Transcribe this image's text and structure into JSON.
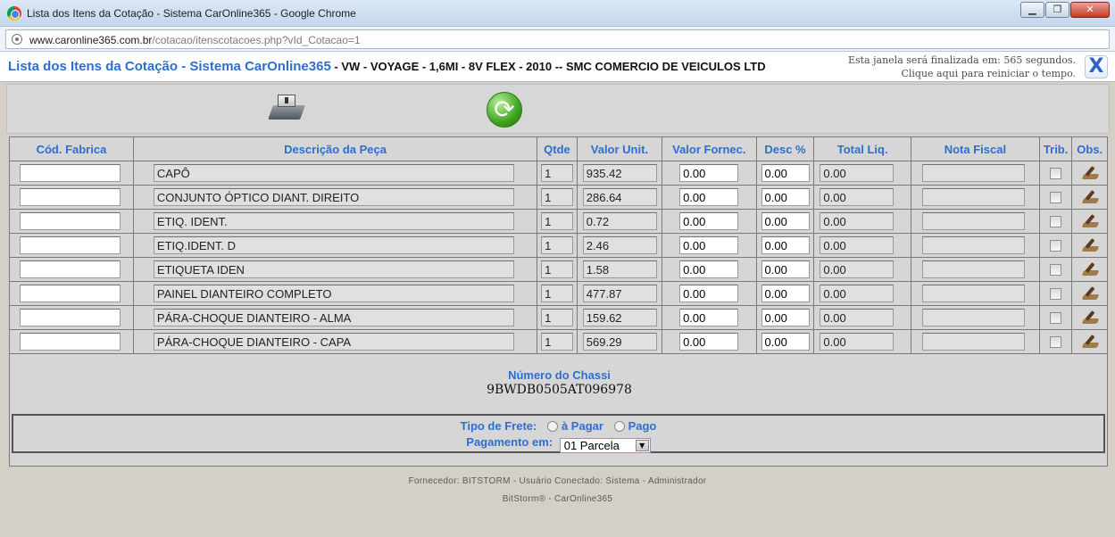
{
  "window": {
    "title": "Lista dos Itens da Cotação - Sistema CarOnline365 - Google Chrome",
    "minimize": "▁",
    "restore": "❐",
    "close": "✕"
  },
  "address": {
    "host": "www.caronline365.com.br",
    "path": "/cotacao/itenscotacoes.php?vId_Cotacao=1"
  },
  "header": {
    "app_title": "Lista dos Itens da Cotação - Sistema CarOnline365",
    "vehicle": " - VW - VOYAGE - 1,6MI - 8V FLEX - 2010 -- SMC COMERCIO DE VEICULOS LTD",
    "timer_line1": "Esta janela será finalizada em: 565 segundos.",
    "timer_line2": "Clique aqui para reiniciar o tempo.",
    "close_label": "X"
  },
  "table": {
    "columns": [
      "Cód. Fabrica",
      "Descrição da Peça",
      "Qtde",
      "Valor Unit.",
      "Valor Fornec.",
      "Desc %",
      "Total Liq.",
      "Nota Fiscal",
      "Trib.",
      "Obs."
    ],
    "rows": [
      {
        "cod": "",
        "desc": "CAPÔ",
        "qtde": "1",
        "valor": "935.42",
        "fornec": "0.00",
        "descpct": "0.00",
        "total": "0.00",
        "nota": ""
      },
      {
        "cod": "",
        "desc": "CONJUNTO ÓPTICO DIANT. DIREITO",
        "qtde": "1",
        "valor": "286.64",
        "fornec": "0.00",
        "descpct": "0.00",
        "total": "0.00",
        "nota": ""
      },
      {
        "cod": "",
        "desc": "ETIQ. IDENT.",
        "qtde": "1",
        "valor": "0.72",
        "fornec": "0.00",
        "descpct": "0.00",
        "total": "0.00",
        "nota": ""
      },
      {
        "cod": "",
        "desc": "ETIQ.IDENT. D",
        "qtde": "1",
        "valor": "2.46",
        "fornec": "0.00",
        "descpct": "0.00",
        "total": "0.00",
        "nota": ""
      },
      {
        "cod": "",
        "desc": "ETIQUETA IDEN",
        "qtde": "1",
        "valor": "1.58",
        "fornec": "0.00",
        "descpct": "0.00",
        "total": "0.00",
        "nota": ""
      },
      {
        "cod": "",
        "desc": "PAINEL DIANTEIRO COMPLETO",
        "qtde": "1",
        "valor": "477.87",
        "fornec": "0.00",
        "descpct": "0.00",
        "total": "0.00",
        "nota": ""
      },
      {
        "cod": "",
        "desc": "PÁRA-CHOQUE DIANTEIRO - ALMA",
        "qtde": "1",
        "valor": "159.62",
        "fornec": "0.00",
        "descpct": "0.00",
        "total": "0.00",
        "nota": ""
      },
      {
        "cod": "",
        "desc": "PÁRA-CHOQUE DIANTEIRO - CAPA",
        "qtde": "1",
        "valor": "569.29",
        "fornec": "0.00",
        "descpct": "0.00",
        "total": "0.00",
        "nota": ""
      }
    ]
  },
  "chassi": {
    "label": "Número do Chassi",
    "value": "9BWDB0505AT096978"
  },
  "frete": {
    "label": "Tipo de Frete:",
    "opt_a_pagar": "à Pagar",
    "opt_pago": "Pago",
    "pagamento_label": "Pagamento em:",
    "pagamento_value": "01 Parcela"
  },
  "footer": {
    "line1": "Fornecedor: BITSTORM - Usuário Conectado: Sistema - Administrador",
    "line2": "BitStorm® - CarOnline365"
  },
  "colors": {
    "accent_blue": "#2f6ecf",
    "panel_gray": "#d6d6d6"
  }
}
